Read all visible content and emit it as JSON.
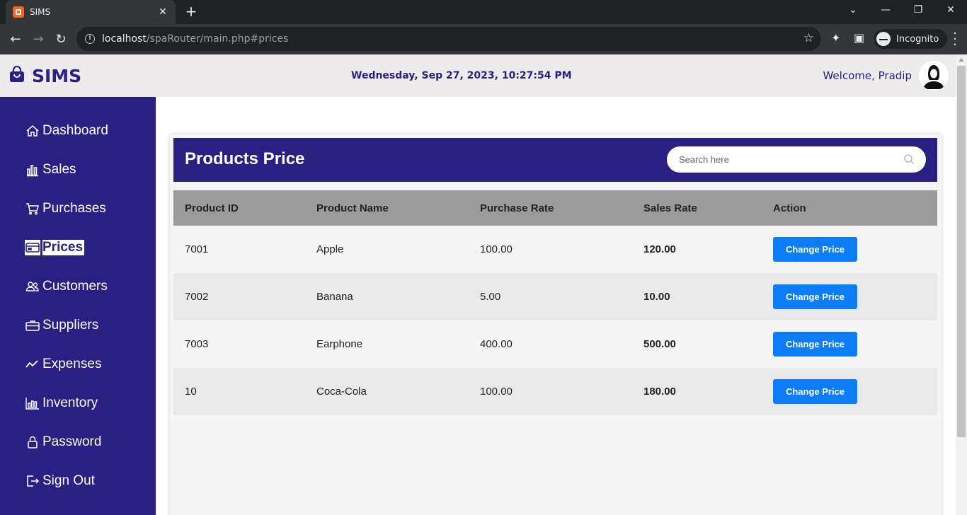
{
  "browser": {
    "tab_title": "SIMS",
    "url_host": "localhost",
    "url_path": "/spaRouter/main.php#prices",
    "incognito_label": "Incognito"
  },
  "header": {
    "logo": "SIMS",
    "datetime": "Wednesday, Sep 27, 2023, 10:27:54 PM",
    "welcome": "Welcome, Pradip"
  },
  "sidebar": {
    "items": [
      {
        "label": "Dashboard",
        "icon": "home-icon"
      },
      {
        "label": "Sales",
        "icon": "bar-chart-icon"
      },
      {
        "label": "Purchases",
        "icon": "cart-icon"
      },
      {
        "label": "Prices",
        "icon": "credit-card-icon",
        "active": true
      },
      {
        "label": "Customers",
        "icon": "people-icon"
      },
      {
        "label": "Suppliers",
        "icon": "briefcase-icon"
      },
      {
        "label": "Expenses",
        "icon": "graph-up-icon"
      },
      {
        "label": "Inventory",
        "icon": "inventory-chart-icon"
      },
      {
        "label": "Password",
        "icon": "lock-icon"
      },
      {
        "label": "Sign Out",
        "icon": "sign-out-icon"
      }
    ]
  },
  "main": {
    "title": "Products Price",
    "search_placeholder": "Search here",
    "columns": [
      "Product ID",
      "Product Name",
      "Purchase Rate",
      "Sales Rate",
      "Action"
    ],
    "rows": [
      {
        "id": "7001",
        "name": "Apple",
        "purchase": "100.00",
        "sales": "120.00",
        "action": "Change Price"
      },
      {
        "id": "7002",
        "name": "Banana",
        "purchase": "5.00",
        "sales": "10.00",
        "action": "Change Price"
      },
      {
        "id": "7003",
        "name": "Earphone",
        "purchase": "400.00",
        "sales": "500.00",
        "action": "Change Price"
      },
      {
        "id": "10",
        "name": "Coca-Cola",
        "purchase": "100.00",
        "sales": "180.00",
        "action": "Change Price"
      }
    ]
  },
  "colors": {
    "brand": "#2a2083",
    "header_bg": "#edebec",
    "button": "#0b7dfa",
    "table_header": "#9b9b9b"
  }
}
